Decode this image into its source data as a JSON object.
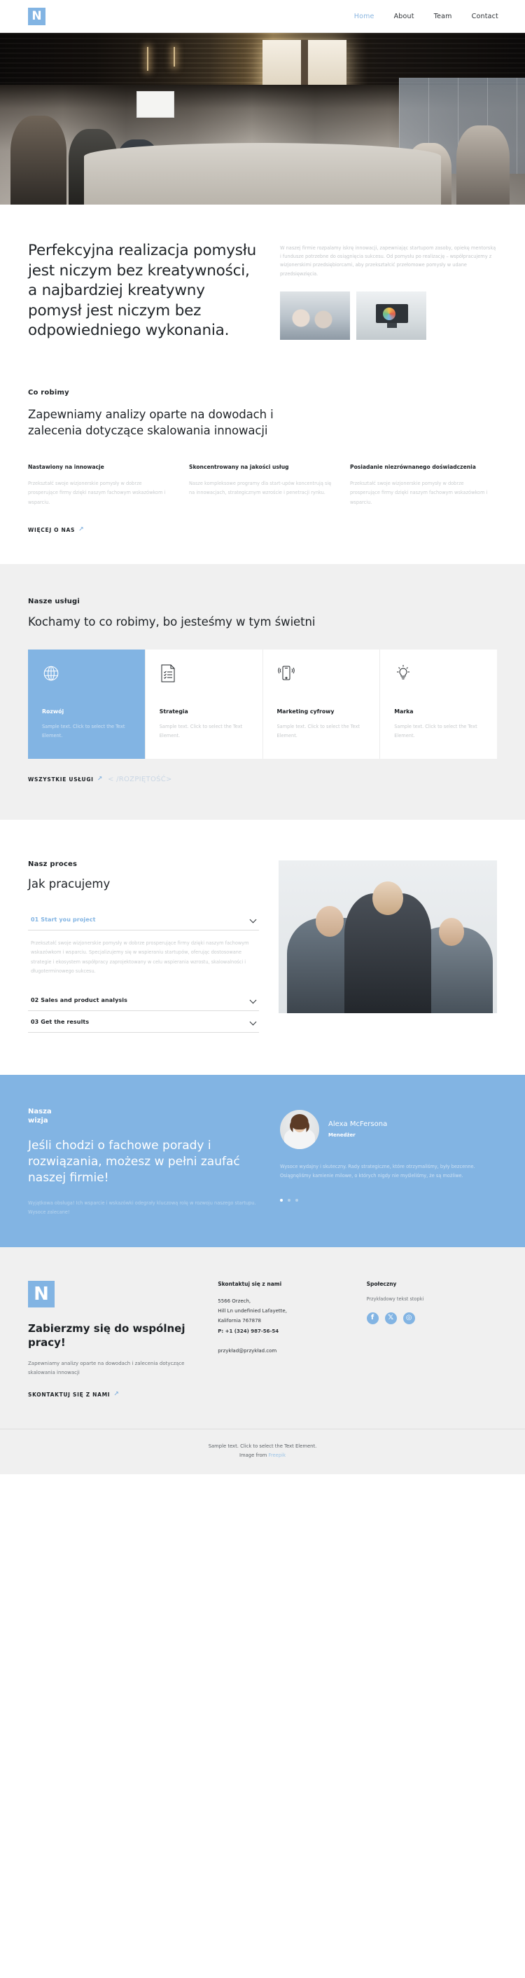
{
  "header": {
    "logo_letter": "N",
    "nav": [
      {
        "label": "Home",
        "active": true
      },
      {
        "label": "About",
        "active": false
      },
      {
        "label": "Team",
        "active": false
      },
      {
        "label": "Contact",
        "active": false
      }
    ]
  },
  "intro": {
    "heading": "Perfekcyjna realizacja pomysłu jest niczym bez kreatywności, a najbardziej kreatywny pomysł jest niczym bez odpowiedniego wykonania.",
    "paragraph": "W naszej firmie rozpalamy iskrę innowacji, zapewniając startupom zasoby, opiekę mentorską i fundusze potrzebne do osiągnięcia sukcesu. Od pomysłu po realizację – współpracujemy z wizjonerskimi przedsiębiorcami, aby przekształcić przełomowe pomysły w udane przedsięwzięcia."
  },
  "whatwedo": {
    "eyebrow": "Co robimy",
    "heading": "Zapewniamy analizy oparte na dowodach i zalecenia dotyczące skalowania innowacji",
    "columns": [
      {
        "title": "Nastawiony na innowacje",
        "text": "Przekształć swoje wizjonerskie pomysły w dobrze prosperujące firmy dzięki naszym fachowym wskazówkom i wsparciu."
      },
      {
        "title": "Skoncentrowany na jakości usług",
        "text": "Nasze kompleksowe programy dla start-upów koncentrują się na innowacjach, strategicznym wzroście i penetracji rynku."
      },
      {
        "title": "Posiadanie niezrównanego doświadczenia",
        "text": "Przekształć swoje wizjonerskie pomysły w dobrze prosperujące firmy dzięki naszym fachowym wskazówkom i wsparciu."
      }
    ],
    "more_link": "WIĘCEJ O NAS"
  },
  "services": {
    "eyebrow": "Nasze usługi",
    "heading": "Kochamy to co robimy, bo jesteśmy w tym świetni",
    "cards": [
      {
        "icon": "globe-icon",
        "title": "Rozwój",
        "text": "Sample text. Click to select the Text Element."
      },
      {
        "icon": "document-checklist-icon",
        "title": "Strategia",
        "text": "Sample text. Click to select the Text Element."
      },
      {
        "icon": "mobile-signal-icon",
        "title": "Marketing cyfrowy",
        "text": "Sample text. Click to select the Text Element."
      },
      {
        "icon": "lightbulb-icon",
        "title": "Marka",
        "text": "Sample text. Click to select the Text Element."
      }
    ],
    "all_link": "WSZYSTKIE USŁUGI",
    "span_tag": "< /ROZPIĘTOŚĆ>"
  },
  "process": {
    "eyebrow": "Nasz proces",
    "heading": "Jak pracujemy",
    "items": [
      {
        "title": "01 Start you project",
        "open": true,
        "body": "Przekształć swoje wizjonerskie pomysły w dobrze prosperujące firmy dzięki naszym fachowym wskazówkom i wsparciu. Specjalizujemy się w wspieraniu startupów, oferując dostosowane strategie i ekosystem współpracy zaprojektowany w celu wspierania wzrostu, skalowalności i długoterminowego sukcesu."
      },
      {
        "title": "02 Sales and product analysis",
        "open": false,
        "body": ""
      },
      {
        "title": "03 Get the results",
        "open": false,
        "body": ""
      }
    ]
  },
  "vision": {
    "eyebrow_line1": "Nasza",
    "eyebrow_line2": "wizja",
    "heading": "Jeśli chodzi o fachowe porady i rozwiązania, możesz w pełni zaufać naszej firmie!",
    "subtext": "Wyjątkowa obsługa! Ich wsparcie i wskazówki odegrały kluczową rolę w rozwoju naszego startupu. Wysoce zalecane!",
    "person_name": "Alexa McFersona",
    "person_role": "Menedżer",
    "quote": "Wysoce wydajny i skuteczny. Rady strategiczne, które otrzymaliśmy, były bezcenne. Osiągnęliśmy kamienie milowe, o których nigdy nie myśleliśmy, że są możliwe.",
    "dots": 3,
    "active_dot": 0
  },
  "footer": {
    "logo_letter": "N",
    "cta_heading": "Zabierzmy się do wspólnej pracy!",
    "cta_text": "Zapewniamy analizy oparte na dowodach i zalecenia dotyczące skalowania innowacji",
    "cta_link": "SKONTAKTUJ SIĘ Z NAMI",
    "contact_title": "Skontaktuj się z nami",
    "address_line1": "5566 Orzech,",
    "address_line2": "Hill Ln undefinied Lafayette,",
    "address_line3": "Kalifornia 767878",
    "phone": "P: +1 (324) 987-56-54",
    "email": "przykład@przykład.com",
    "social_title": "Społeczny",
    "social_note": "Przykładowy tekst stopki",
    "socials": [
      {
        "name": "facebook-icon",
        "glyph": "f"
      },
      {
        "name": "x-twitter-icon",
        "glyph": "𝕏"
      },
      {
        "name": "instagram-icon",
        "glyph": "◎"
      }
    ],
    "bottom_line1": "Sample text. Click to select the Text Element.",
    "bottom_line2_prefix": "Image from ",
    "bottom_line2_link": "Freepik"
  },
  "colors": {
    "accent": "#82b4e3",
    "light_bg": "#f0f0f0",
    "text": "#1b1f23",
    "muted": "#c9ccce"
  }
}
